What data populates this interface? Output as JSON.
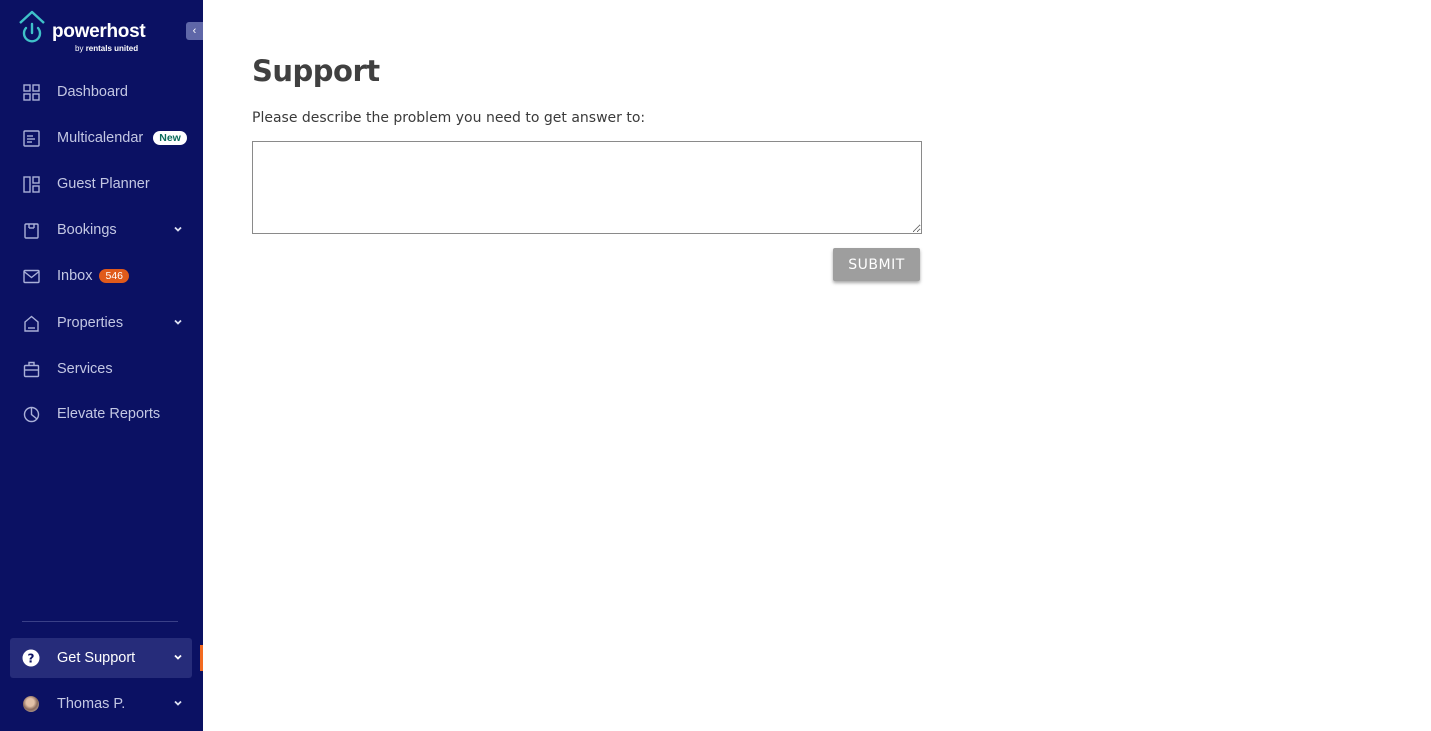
{
  "brand": {
    "name": "powerhost",
    "by": "by",
    "company": "rentals united"
  },
  "sidebar": {
    "collapse_glyph": "‹",
    "items": [
      {
        "label": "Dashboard",
        "icon": "dashboard-grid-icon"
      },
      {
        "label": "Multicalendar",
        "icon": "calendar-list-icon",
        "badge": "New"
      },
      {
        "label": "Guest Planner",
        "icon": "planner-layout-icon"
      },
      {
        "label": "Bookings",
        "icon": "clipboard-icon",
        "expandable": true
      },
      {
        "label": "Inbox",
        "icon": "mail-icon",
        "badge": "546"
      },
      {
        "label": "Properties",
        "icon": "home-icon",
        "expandable": true
      },
      {
        "label": "Services",
        "icon": "briefcase-icon"
      },
      {
        "label": "Elevate Reports",
        "icon": "pie-chart-icon"
      }
    ],
    "footer": [
      {
        "label": "Get Support",
        "icon": "help-circle-icon",
        "active": true
      },
      {
        "label": "Thomas P.",
        "icon": "avatar"
      }
    ]
  },
  "main": {
    "title": "Support",
    "prompt": "Please describe the problem you need to get answer to:",
    "textarea_value": "",
    "submit_label": "SUBMIT"
  },
  "colors": {
    "sidebar_bg": "#0b1163",
    "active_marker": "#f26b21",
    "badge_count": "#e05a1b",
    "submit_bg": "#9e9e9e"
  }
}
